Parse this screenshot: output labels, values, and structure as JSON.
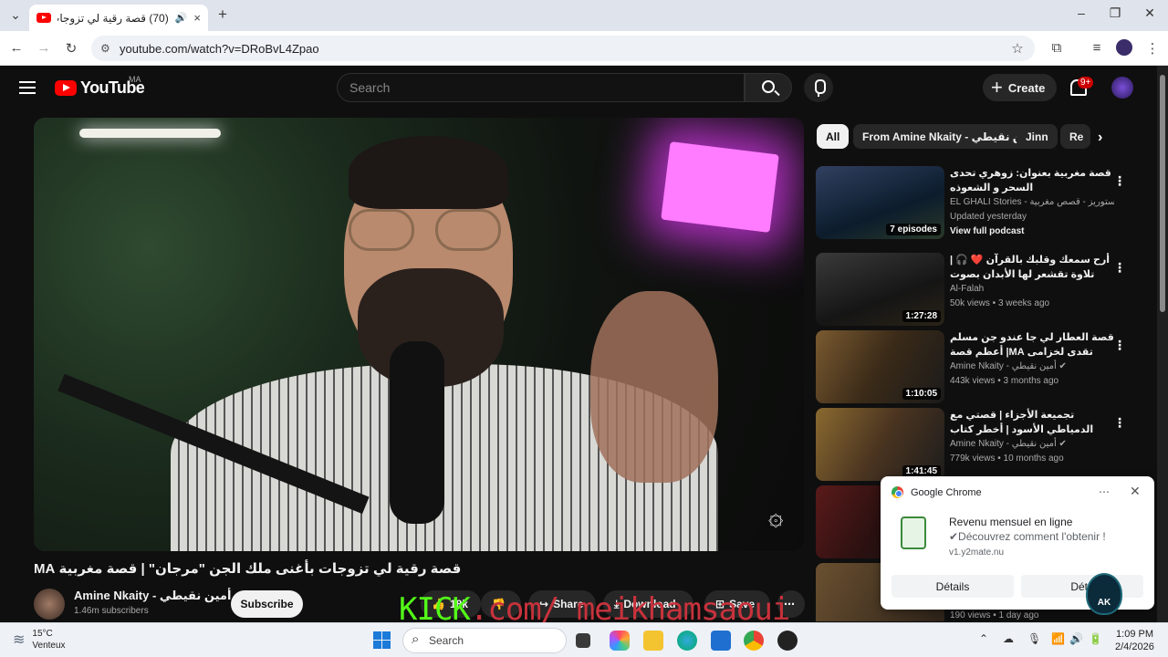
{
  "browser": {
    "tab_title": "(70) قصة رقية لي تزوجات بأغ",
    "url": "youtube.com/watch?v=DRoBvL4Zpao"
  },
  "youtube": {
    "logo_text": "YouTube",
    "region": "MA",
    "search_placeholder": "Search",
    "create_label": "Create",
    "notifications_badge": "9+"
  },
  "chips": [
    "All",
    "From Amine Nkaity - أمين نقيطي",
    "Jinn",
    "Re"
  ],
  "recommendations": [
    {
      "title": "قصة مغربية بعنوان: زوهري تحدى السحر و الشعوذه",
      "channel": "EL GHALI Stories - الغالي ستوريز - قصص مغربية •",
      "meta": "Updated yesterday",
      "extra": "View full podcast",
      "badge": "7 episodes"
    },
    {
      "title": "أرح سمعك وقلبك بالقرآن ❤️ 🎧 | تلاوة تقشعر لها الأبدان بصوت محمد هشام | ...",
      "channel": "Al-Falah",
      "meta": "50k views • 3 weeks ago",
      "duration": "1:27:28"
    },
    {
      "title": "قصة العطار لي جا عندو جن مسلم تقدى لخزامى MA| أعظم قصة غتسمعها في حياتك ...",
      "channel": "Amine Nkaity - أمين نقيطي",
      "meta": "443k views • 3 months ago",
      "duration": "1:10:05"
    },
    {
      "title": "تجميعة الأجزاء | قصتي مع الدمياطي الأسود | أخطر كتاب سامعين بيه و ماعارفين 🔥 ...",
      "channel": "Amine Nkaity - أمين نقيطي",
      "meta": "779k views • 10 months ago",
      "duration": "1:41:45"
    },
    {
      "meta": "190 views • 1 day ago"
    }
  ],
  "video": {
    "title": "قصة رقية لي تزوجات بأغنى ملك الجن \"مرجان\" | قصة مغربية MA",
    "channel": "Amine Nkaity - أمين نقيطي",
    "subscribers": "1.46m subscribers",
    "subscribe_label": "Subscribe",
    "likes": "18k",
    "share_label": "Share",
    "download_label": "Download",
    "save_label": "Save"
  },
  "overlay": {
    "kick": "KICK",
    "handle": ".com/ meikhamsaoui"
  },
  "notification": {
    "app": "Google Chrome",
    "title": "Revenu mensuel en ligne",
    "body": "✔Découvrez comment l'obtenir !",
    "source": "v1.y2mate.nu",
    "btn1": "Détails",
    "btn2": "Déta"
  },
  "taskbar": {
    "temp": "15°C",
    "weather": "Venteux",
    "search": "Search",
    "time": "1:09 PM",
    "date": "2/4/2026"
  },
  "colors": {
    "youtube_red": "#ff0000",
    "kick_green": "#53fc18"
  }
}
